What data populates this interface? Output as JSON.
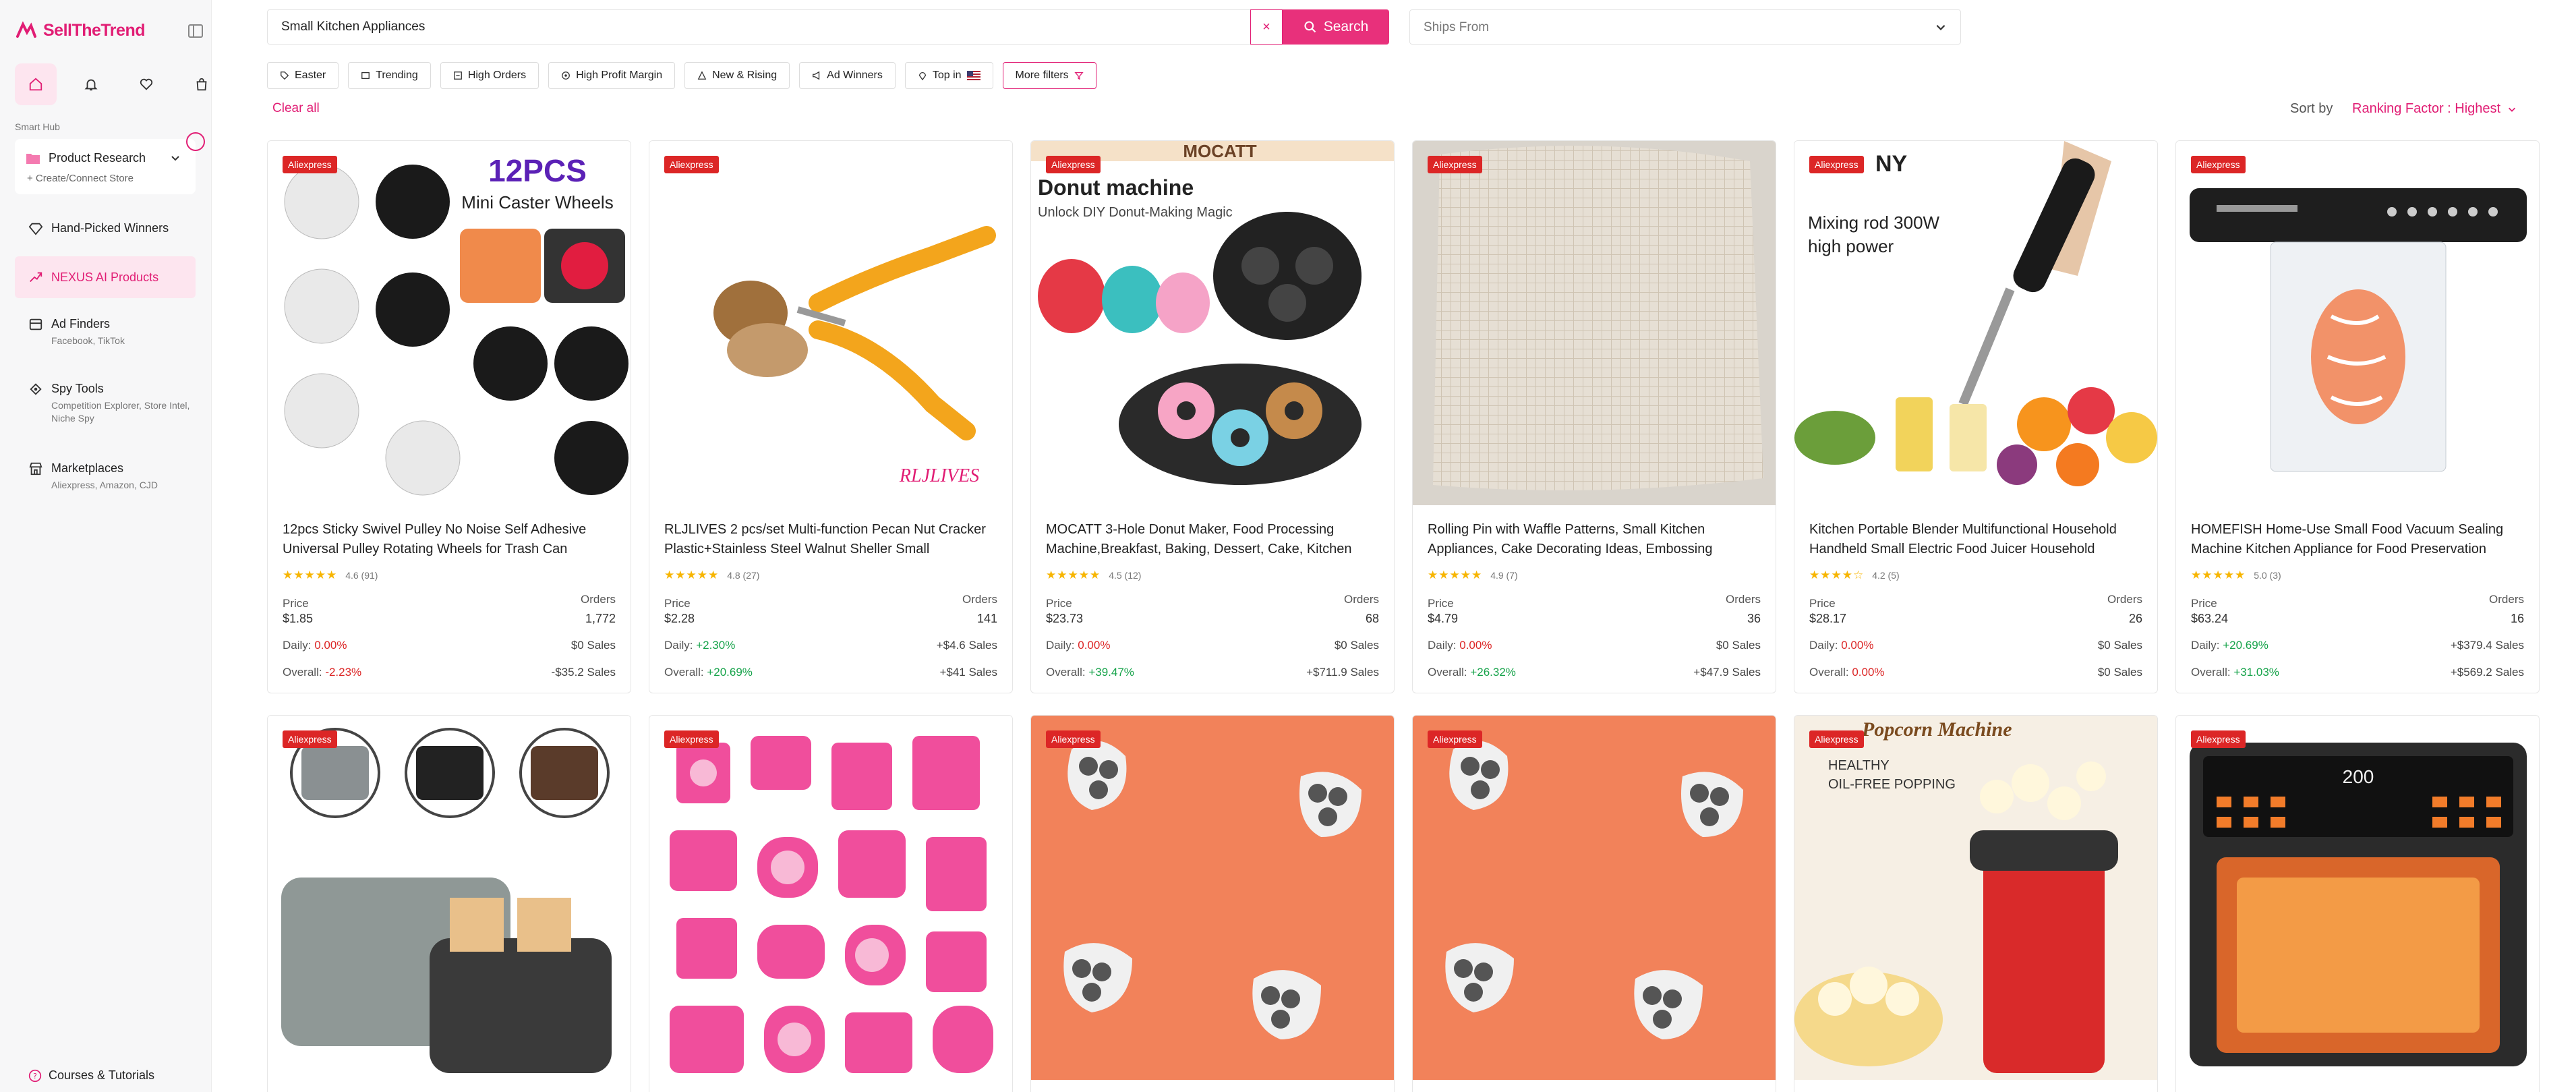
{
  "sidebar": {
    "brand": "SellTheTrend",
    "smart_hub": "Smart Hub",
    "product_research": {
      "label": "Product Research",
      "sub": "+ Create/Connect Store"
    },
    "hand_picked": "Hand-Picked Winners",
    "nexus": "NEXUS AI Products",
    "ad_finders": {
      "label": "Ad Finders",
      "sub": "Facebook, TikTok"
    },
    "spy_tools": {
      "label": "Spy Tools",
      "sub": "Competition Explorer, Store Intel, Niche Spy"
    },
    "marketplaces": {
      "label": "Marketplaces",
      "sub": "Aliexpress, Amazon, CJD"
    },
    "courses": "Courses & Tutorials"
  },
  "search": {
    "value": "Small Kitchen Appliances",
    "clear": "×",
    "button": "Search",
    "ships_from_placeholder": "Ships From"
  },
  "filters": [
    {
      "label": "Easter",
      "icon": "tag-icon"
    },
    {
      "label": "Trending",
      "icon": "trend-icon"
    },
    {
      "label": "High Orders",
      "icon": "orders-icon"
    },
    {
      "label": "High Profit Margin",
      "icon": "profit-icon"
    },
    {
      "label": "New & Rising",
      "icon": "rising-icon"
    },
    {
      "label": "Ad Winners",
      "icon": "megaphone-icon"
    },
    {
      "label": "Top in",
      "icon": "pin-icon"
    }
  ],
  "more_filters": "More filters",
  "clear_all": "Clear all",
  "sort": {
    "label": "Sort by",
    "value": "Ranking Factor : Highest"
  },
  "labels": {
    "price": "Price",
    "orders": "Orders",
    "daily": "Daily:",
    "overall": "Overall:",
    "badge": "Aliexpress"
  },
  "products": [
    {
      "title": "12pcs Sticky Swivel Pulley No Noise Self Adhesive Universal Pulley Rotating Wheels for Trash Can",
      "rating": "4.6 (91)",
      "price": "$1.85",
      "orders": "1,772",
      "daily": "0.00%",
      "daily_sales": "$0 Sales",
      "overall": "-2.23%",
      "overall_sales": "-$35.2 Sales"
    },
    {
      "title": "RLJLIVES 2 pcs/set Multi-function Pecan Nut Cracker Plastic+Stainless Steel Walnut Sheller Small",
      "rating": "4.8 (27)",
      "price": "$2.28",
      "orders": "141",
      "daily": "+2.30%",
      "daily_sales": "+$4.6 Sales",
      "overall": "+20.69%",
      "overall_sales": "+$41 Sales"
    },
    {
      "title": "MOCATT 3-Hole Donut Maker, Food Processing Machine,Breakfast, Baking, Dessert, Cake, Kitchen",
      "rating": "4.5 (12)",
      "price": "$23.73",
      "orders": "68",
      "daily": "0.00%",
      "daily_sales": "$0 Sales",
      "overall": "+39.47%",
      "overall_sales": "+$711.9 Sales"
    },
    {
      "title": "Rolling Pin with Waffle Patterns, Small Kitchen Appliances, Cake Decorating Ideas, Embossing",
      "rating": "4.9 (7)",
      "price": "$4.79",
      "orders": "36",
      "daily": "0.00%",
      "daily_sales": "$0 Sales",
      "overall": "+26.32%",
      "overall_sales": "+$47.9 Sales"
    },
    {
      "title": "Kitchen Portable Blender Multifunctional Household Handheld Small Electric Food Juicer Household",
      "rating": "4.2 (5)",
      "price": "$28.17",
      "orders": "26",
      "daily": "0.00%",
      "daily_sales": "$0 Sales",
      "overall": "0.00%",
      "overall_sales": "$0 Sales"
    },
    {
      "title": "HOMEFISH Home-Use Small Food Vacuum Sealing Machine Kitchen Appliance for Food Preservation",
      "rating": "5.0 (3)",
      "price": "$63.24",
      "orders": "16",
      "daily": "+20.69%",
      "daily_sales": "+$379.4 Sales",
      "overall": "+31.03%",
      "overall_sales": "+$569.2 Sales"
    }
  ],
  "image_text": {
    "p1_heading": "12PCS",
    "p1_sub": "Mini Caster Wheels",
    "p2_wm": "RLJLIVES",
    "p3_brand": "MOCATT",
    "p3_heading": "Donut machine",
    "p3_sub": "Unlock DIY Donut-Making Magic",
    "p5_brand": "NY",
    "p5_heading": "Mixing rod 300W",
    "p5_sub": "high power",
    "p11_heading": "Popcorn Machine",
    "p11_sub1": "HEALTHY",
    "p11_sub2": "OIL-FREE POPPING",
    "p12_display": "200"
  }
}
